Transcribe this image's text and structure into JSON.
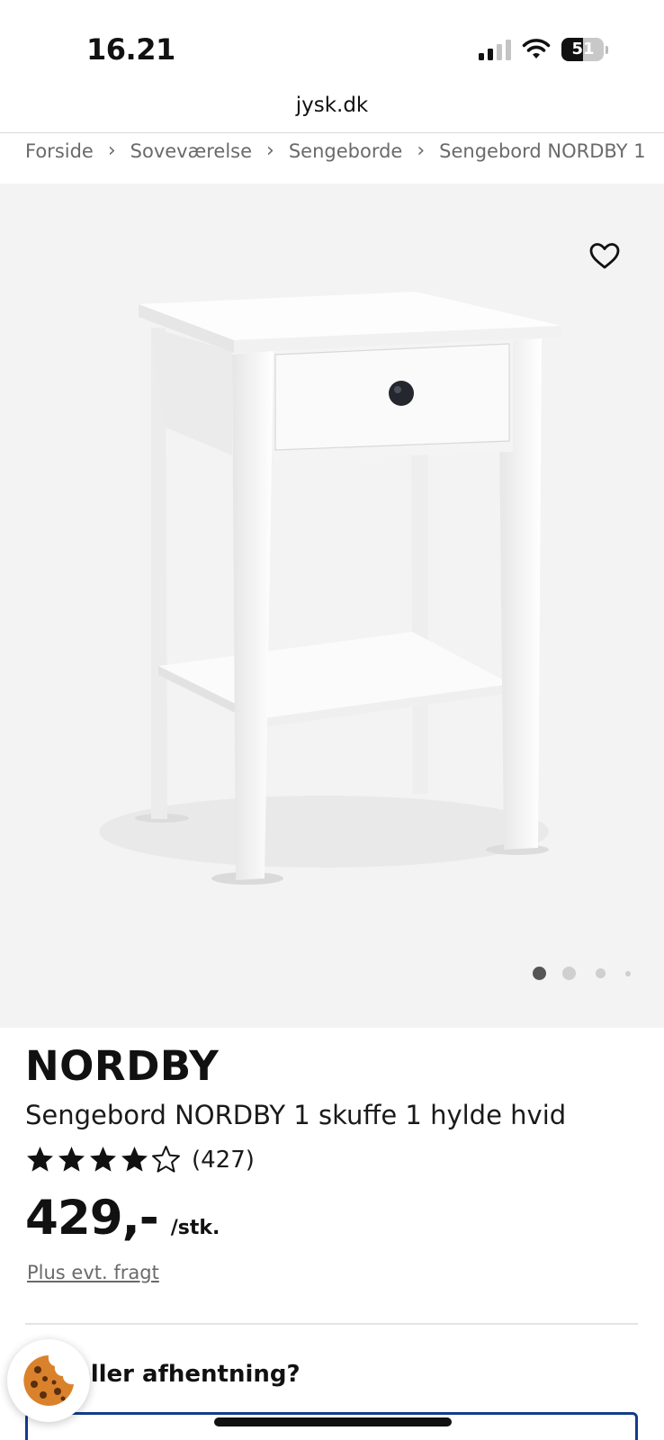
{
  "status_bar": {
    "time": "16.21",
    "battery": "51",
    "battery_level": 0.51
  },
  "browser": {
    "url": "jysk.dk"
  },
  "breadcrumb": [
    {
      "label": "Forside"
    },
    {
      "label": "Soveværelse"
    },
    {
      "label": "Sengeborde"
    },
    {
      "label": "Sengebord NORDBY 1"
    }
  ],
  "breadcrumb_separator": "›",
  "gallery": {
    "image_count": 4,
    "active_index": 0,
    "icons": {
      "favorite": "heart-icon"
    }
  },
  "product": {
    "brand": "NORDBY",
    "title": "Sengebord NORDBY 1 skuffe 1 hylde hvid",
    "rating": 4.5,
    "rating_max": 5,
    "review_count": "(427)",
    "price": "429,-",
    "price_unit": "/stk.",
    "shipping_note": "Plus evt. fragt"
  },
  "delivery": {
    "heading": "ing eller afhentning?"
  },
  "cookie_button": {
    "icon": "cookie-icon"
  },
  "colors": {
    "accent_border": "#143c8a",
    "image_background": "#f3f3f3",
    "text_muted": "#6a6a6a"
  }
}
